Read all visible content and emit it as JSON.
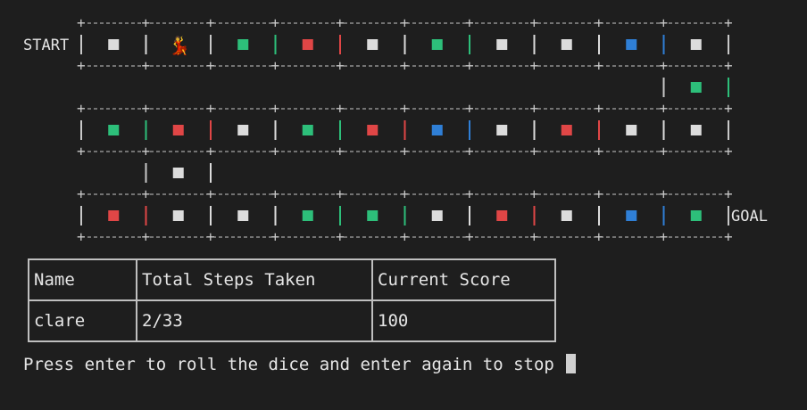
{
  "colors": {
    "green": "#2dbf7a",
    "red": "#e04646",
    "white": "#dcdcdc",
    "blue": "#2f7fd6"
  },
  "board": {
    "start_label": "START",
    "goal_label": "GOAL",
    "player_icon": "dancer-emoji",
    "rows": [
      [
        "white",
        "player",
        "green",
        "red",
        "white",
        "green",
        "white",
        "white",
        "blue",
        "white"
      ],
      [
        "green"
      ],
      [
        "green",
        "red",
        "white",
        "green",
        "red",
        "blue",
        "white",
        "red",
        "white",
        "white"
      ],
      [
        "white"
      ],
      [
        "red",
        "white",
        "white",
        "green",
        "green",
        "white",
        "red",
        "white",
        "blue",
        "green"
      ]
    ]
  },
  "table": {
    "headers": [
      "Name",
      "Total Steps Taken",
      "Current Score"
    ],
    "rows": [
      [
        "clare",
        "2/33",
        "100"
      ]
    ]
  },
  "prompt": "Press enter to roll the dice and enter again to stop"
}
